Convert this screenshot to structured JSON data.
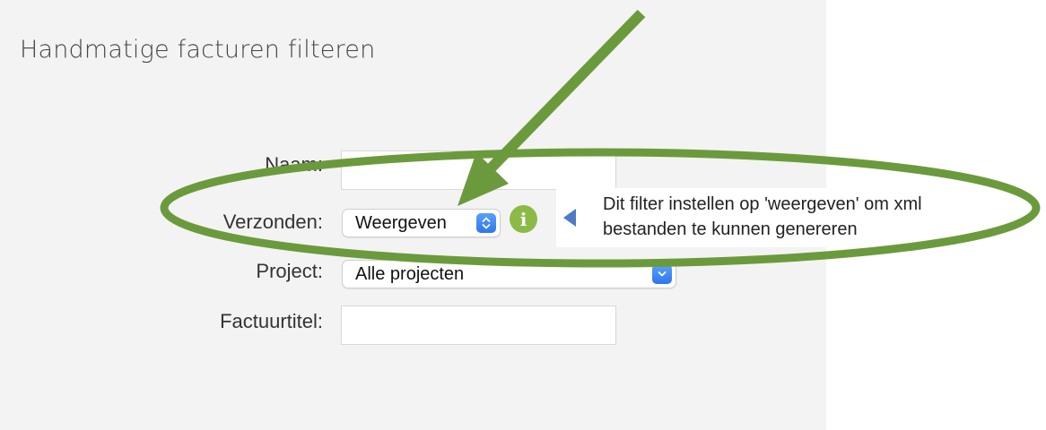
{
  "page": {
    "title": "Handmatige facturen filteren"
  },
  "form": {
    "naam": {
      "label": "Naam:",
      "value": ""
    },
    "verzonden": {
      "label": "Verzonden:",
      "value": "Weergeven"
    },
    "project": {
      "label": "Project:",
      "value": "Alle projecten"
    },
    "factuurtitel": {
      "label": "Factuurtitel:",
      "value": ""
    }
  },
  "info": {
    "glyph": "i"
  },
  "tooltip": {
    "text": "Dit filter instellen op 'weergeven' om xml bestanden te kunnen genereren"
  },
  "annotation": {
    "color": "#6b9a3c"
  }
}
